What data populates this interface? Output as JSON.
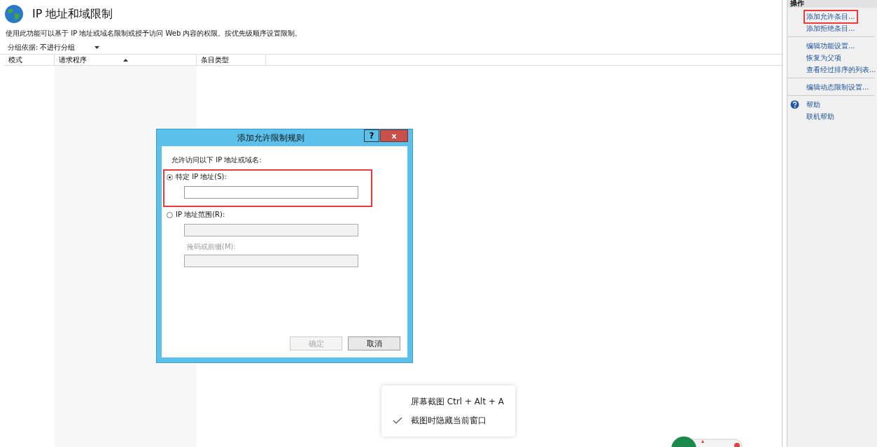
{
  "page": {
    "title": "IP 地址和域限制",
    "description": "使用此功能可以基于 IP 地址或域名限制或授予访问 Web 内容的权限。按优先级顺序设置限制。",
    "group_by": {
      "label": "分组依据:",
      "value": "不进行分组"
    },
    "columns": [
      {
        "label": "模式",
        "sorted": false
      },
      {
        "label": "请求程序",
        "sorted": true
      },
      {
        "label": "条目类型",
        "sorted": false
      }
    ]
  },
  "actions": {
    "title": "操作",
    "groups": [
      [
        {
          "label": "添加允许条目...",
          "highlighted": true,
          "kind": "link"
        },
        {
          "label": "添加拒绝条目...",
          "highlighted": false,
          "kind": "link"
        }
      ],
      [
        {
          "label": "编辑功能设置...",
          "highlighted": false,
          "kind": "link"
        },
        {
          "label": "恢复为父项",
          "highlighted": false,
          "kind": "link"
        },
        {
          "label": "查看经过排序的列表...",
          "highlighted": false,
          "kind": "link"
        }
      ],
      [
        {
          "label": "编辑动态限制设置...",
          "highlighted": false,
          "kind": "link"
        }
      ],
      [
        {
          "label": "帮助",
          "highlighted": false,
          "kind": "help"
        },
        {
          "label": "联机帮助",
          "highlighted": false,
          "kind": "link"
        }
      ]
    ]
  },
  "dialog": {
    "title": "添加允许限制规则",
    "help": "?",
    "close": "x",
    "prompt": "允许访问以下 IP 地址或域名:",
    "options": [
      {
        "label": "特定 IP 地址(S):",
        "selected": true,
        "highlighted": true,
        "fields": [
          {
            "disabled": false
          }
        ]
      },
      {
        "label": "IP 地址范围(R):",
        "selected": false,
        "highlighted": false,
        "fields": [
          {
            "disabled": true
          },
          {
            "label": "掩码或前缀(M):",
            "disabled": true
          }
        ]
      }
    ],
    "buttons": [
      {
        "label": "确定",
        "disabled": true
      },
      {
        "label": "取消",
        "disabled": false
      }
    ]
  },
  "context_menu": [
    {
      "label": "屏幕截图 Ctrl + Alt + A",
      "checked": false
    },
    {
      "label": "截图时隐藏当前窗口",
      "checked": true
    }
  ]
}
